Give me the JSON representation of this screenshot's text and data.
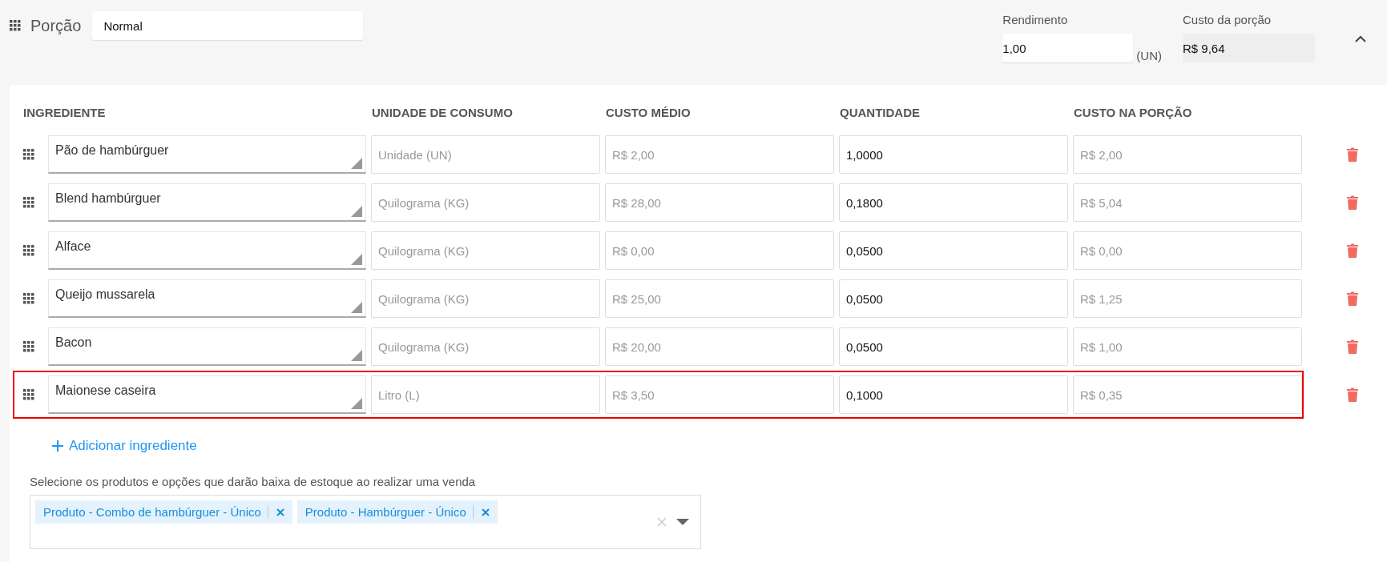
{
  "portion": {
    "label": "Porção",
    "name_value": "Normal",
    "yield_label": "Rendimento",
    "yield_value": "1,00",
    "yield_unit": "(UN)",
    "cost_label": "Custo da porção",
    "cost_value": "R$ 9,64",
    "expanded": true
  },
  "table": {
    "columns": [
      "INGREDIENTE",
      "UNIDADE DE CONSUMO",
      "CUSTO MÉDIO",
      "QUANTIDADE",
      "CUSTO NA PORÇÃO"
    ],
    "rows": [
      {
        "ingredient": "Pão de hambúrguer",
        "unit": "Unidade (UN)",
        "avg_cost": "R$ 2,00",
        "quantity": "1,0000",
        "portion_cost": "R$ 2,00",
        "highlighted": false
      },
      {
        "ingredient": "Blend hambúrguer",
        "unit": "Quilograma (KG)",
        "avg_cost": "R$ 28,00",
        "quantity": "0,1800",
        "portion_cost": "R$ 5,04",
        "highlighted": false
      },
      {
        "ingredient": "Alface",
        "unit": "Quilograma (KG)",
        "avg_cost": "R$ 0,00",
        "quantity": "0,0500",
        "portion_cost": "R$ 0,00",
        "highlighted": false
      },
      {
        "ingredient": "Queijo mussarela",
        "unit": "Quilograma (KG)",
        "avg_cost": "R$ 25,00",
        "quantity": "0,0500",
        "portion_cost": "R$ 1,25",
        "highlighted": false
      },
      {
        "ingredient": "Bacon",
        "unit": "Quilograma (KG)",
        "avg_cost": "R$ 20,00",
        "quantity": "0,0500",
        "portion_cost": "R$ 1,00",
        "highlighted": false
      },
      {
        "ingredient": "Maionese caseira",
        "unit": "Litro (L)",
        "avg_cost": "R$ 3,50",
        "quantity": "0,1000",
        "portion_cost": "R$ 0,35",
        "highlighted": true
      }
    ]
  },
  "add_ingredient": "Adicionar ingrediente",
  "products": {
    "label": "Selecione os produtos e opções que darão baixa de estoque ao realizar uma venda",
    "tags": [
      "Produto - Combo de hambúrguer - Único",
      "Produto - Hambúrguer - Único"
    ]
  }
}
